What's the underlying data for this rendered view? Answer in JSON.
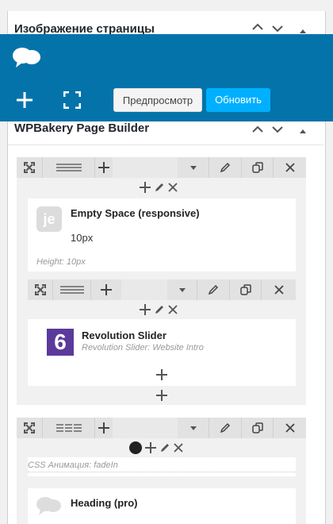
{
  "metabox_top": {
    "title": "Изображение страницы"
  },
  "toolbar": {
    "preview_label": "Предпросмотр",
    "update_label": "Обновить"
  },
  "builder": {
    "title": "WPBakery Page Builder"
  },
  "elements": {
    "empty_space": {
      "title": "Empty Space (responsive)",
      "value": "10px",
      "height_note": "Height: 10px",
      "icon_text": "je"
    },
    "revolution": {
      "title": "Revolution Slider",
      "subtitle": "Revolution Slider: Website Intro",
      "icon_text": "6"
    },
    "css_anim": {
      "label": "CSS Анимация: fadeIn"
    },
    "heading": {
      "title": "Heading (pro)"
    }
  },
  "colors": {
    "toolbar": "#0473aa",
    "update": "#00b0ff",
    "revolution_icon": "#5b3a9b"
  },
  "icons": [
    "speech-bubbles-icon",
    "plus-icon",
    "fullscreen-icon",
    "chevron-up-icon",
    "chevron-down-icon",
    "triangle-up-icon",
    "move-icon",
    "layout-icon",
    "pencil-icon",
    "copy-icon",
    "close-icon",
    "dropdown-icon"
  ]
}
